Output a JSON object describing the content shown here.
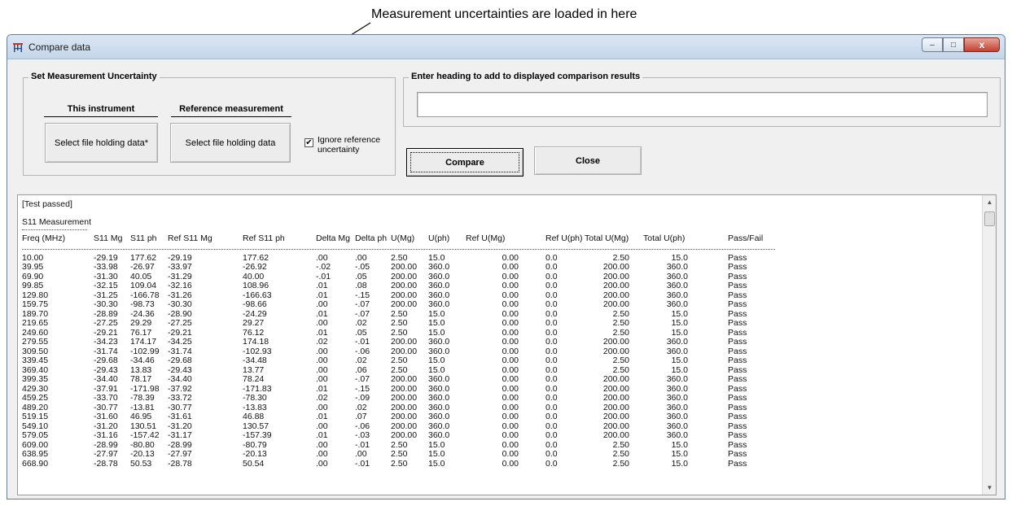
{
  "annotation": {
    "text": "Measurement uncertainties are loaded in here"
  },
  "window": {
    "title": "Compare data",
    "icon": "chart-icon",
    "controls": {
      "minimize": "–",
      "maximize": "□",
      "close": "x"
    }
  },
  "uncertainty": {
    "legend": "Set Measurement Uncertainty",
    "this_instrument": {
      "heading": "This instrument",
      "button": "Select file holding data*"
    },
    "reference": {
      "heading": "Reference measurement",
      "button": "Select file holding data"
    },
    "ignore_ref": {
      "checked": true,
      "label_line1": "Ignore reference",
      "label_line2": "uncertainty"
    }
  },
  "heading_group": {
    "legend": "Enter heading to add to displayed comparison results",
    "value": ""
  },
  "buttons": {
    "compare": "Compare",
    "close": "Close"
  },
  "results": {
    "status": "[Test passed]",
    "section": "S11 Measurement",
    "columns": [
      "Freq (MHz)",
      "S11 Mg",
      "S11 ph",
      "Ref S11 Mg",
      "Ref S11 ph",
      "Delta Mg",
      "Delta ph",
      "U(Mg)",
      "U(ph)",
      "Ref U(Mg)",
      "Ref U(ph)",
      "Total U(Mg)",
      "Total U(ph)",
      "Pass/Fail"
    ],
    "rows": [
      [
        "10.00",
        "-29.19",
        "177.62",
        "-29.19",
        "177.62",
        ".00",
        ".00",
        "2.50",
        "15.0",
        "0.00",
        "0.0",
        "2.50",
        "15.0",
        "Pass"
      ],
      [
        "39.95",
        "-33.98",
        "-26.97",
        "-33.97",
        "-26.92",
        "-.02",
        "-.05",
        "200.00",
        "360.0",
        "0.00",
        "0.0",
        "200.00",
        "360.0",
        "Pass"
      ],
      [
        "69.90",
        "-31.30",
        "40.05",
        "-31.29",
        "40.00",
        "-.01",
        ".05",
        "200.00",
        "360.0",
        "0.00",
        "0.0",
        "200.00",
        "360.0",
        "Pass"
      ],
      [
        "99.85",
        "-32.15",
        "109.04",
        "-32.16",
        "108.96",
        ".01",
        ".08",
        "200.00",
        "360.0",
        "0.00",
        "0.0",
        "200.00",
        "360.0",
        "Pass"
      ],
      [
        "129.80",
        "-31.25",
        "-166.78",
        "-31.26",
        "-166.63",
        ".01",
        "-.15",
        "200.00",
        "360.0",
        "0.00",
        "0.0",
        "200.00",
        "360.0",
        "Pass"
      ],
      [
        "159.75",
        "-30.30",
        "-98.73",
        "-30.30",
        "-98.66",
        ".00",
        "-.07",
        "200.00",
        "360.0",
        "0.00",
        "0.0",
        "200.00",
        "360.0",
        "Pass"
      ],
      [
        "189.70",
        "-28.89",
        "-24.36",
        "-28.90",
        "-24.29",
        ".01",
        "-.07",
        "2.50",
        "15.0",
        "0.00",
        "0.0",
        "2.50",
        "15.0",
        "Pass"
      ],
      [
        "219.65",
        "-27.25",
        "29.29",
        "-27.25",
        "29.27",
        ".00",
        ".02",
        "2.50",
        "15.0",
        "0.00",
        "0.0",
        "2.50",
        "15.0",
        "Pass"
      ],
      [
        "249.60",
        "-29.21",
        "76.17",
        "-29.21",
        "76.12",
        ".01",
        ".05",
        "2.50",
        "15.0",
        "0.00",
        "0.0",
        "2.50",
        "15.0",
        "Pass"
      ],
      [
        "279.55",
        "-34.23",
        "174.17",
        "-34.25",
        "174.18",
        ".02",
        "-.01",
        "200.00",
        "360.0",
        "0.00",
        "0.0",
        "200.00",
        "360.0",
        "Pass"
      ],
      [
        "309.50",
        "-31.74",
        "-102.99",
        "-31.74",
        "-102.93",
        ".00",
        "-.06",
        "200.00",
        "360.0",
        "0.00",
        "0.0",
        "200.00",
        "360.0",
        "Pass"
      ],
      [
        "339.45",
        "-29.68",
        "-34.46",
        "-29.68",
        "-34.48",
        ".00",
        ".02",
        "2.50",
        "15.0",
        "0.00",
        "0.0",
        "2.50",
        "15.0",
        "Pass"
      ],
      [
        "369.40",
        "-29.43",
        "13.83",
        "-29.43",
        "13.77",
        ".00",
        ".06",
        "2.50",
        "15.0",
        "0.00",
        "0.0",
        "2.50",
        "15.0",
        "Pass"
      ],
      [
        "399.35",
        "-34.40",
        "78.17",
        "-34.40",
        "78.24",
        ".00",
        "-.07",
        "200.00",
        "360.0",
        "0.00",
        "0.0",
        "200.00",
        "360.0",
        "Pass"
      ],
      [
        "429.30",
        "-37.91",
        "-171.98",
        "-37.92",
        "-171.83",
        ".01",
        "-.15",
        "200.00",
        "360.0",
        "0.00",
        "0.0",
        "200.00",
        "360.0",
        "Pass"
      ],
      [
        "459.25",
        "-33.70",
        "-78.39",
        "-33.72",
        "-78.30",
        ".02",
        "-.09",
        "200.00",
        "360.0",
        "0.00",
        "0.0",
        "200.00",
        "360.0",
        "Pass"
      ],
      [
        "489.20",
        "-30.77",
        "-13.81",
        "-30.77",
        "-13.83",
        ".00",
        ".02",
        "200.00",
        "360.0",
        "0.00",
        "0.0",
        "200.00",
        "360.0",
        "Pass"
      ],
      [
        "519.15",
        "-31.60",
        "46.95",
        "-31.61",
        "46.88",
        ".01",
        ".07",
        "200.00",
        "360.0",
        "0.00",
        "0.0",
        "200.00",
        "360.0",
        "Pass"
      ],
      [
        "549.10",
        "-31.20",
        "130.51",
        "-31.20",
        "130.57",
        ".00",
        "-.06",
        "200.00",
        "360.0",
        "0.00",
        "0.0",
        "200.00",
        "360.0",
        "Pass"
      ],
      [
        "579.05",
        "-31.16",
        "-157.42",
        "-31.17",
        "-157.39",
        ".01",
        "-.03",
        "200.00",
        "360.0",
        "0.00",
        "0.0",
        "200.00",
        "360.0",
        "Pass"
      ],
      [
        "609.00",
        "-28.99",
        "-80.80",
        "-28.99",
        "-80.79",
        ".00",
        "-.01",
        "2.50",
        "15.0",
        "0.00",
        "0.0",
        "2.50",
        "15.0",
        "Pass"
      ],
      [
        "638.95",
        "-27.97",
        "-20.13",
        "-27.97",
        "-20.13",
        ".00",
        ".00",
        "2.50",
        "15.0",
        "0.00",
        "0.0",
        "2.50",
        "15.0",
        "Pass"
      ],
      [
        "668.90",
        "-28.78",
        "50.53",
        "-28.78",
        "50.54",
        ".00",
        "-.01",
        "2.50",
        "15.0",
        "0.00",
        "0.0",
        "2.50",
        "15.0",
        "Pass"
      ]
    ]
  }
}
